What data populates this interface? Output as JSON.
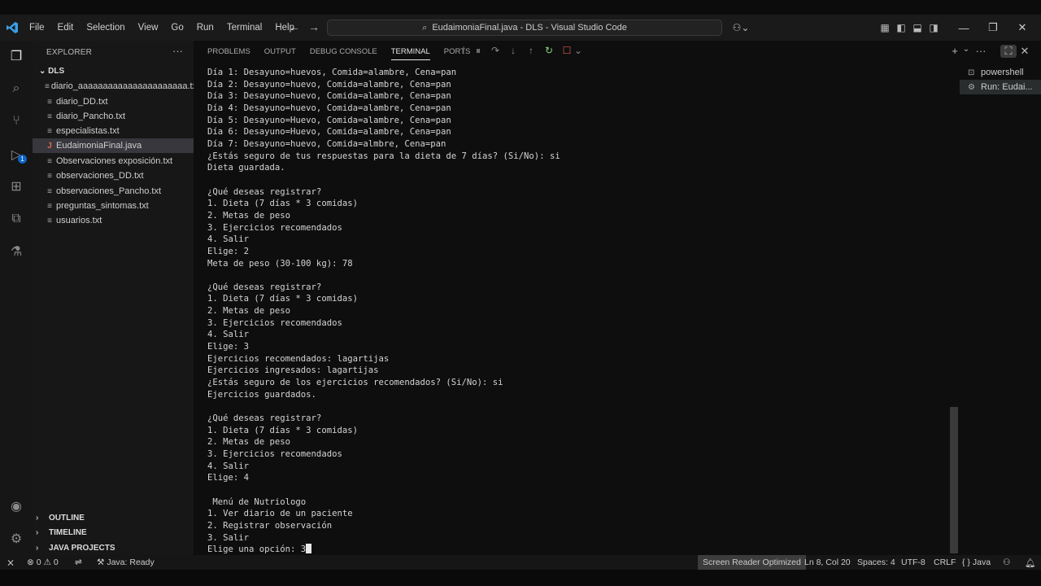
{
  "titlebar": {
    "menu": [
      "File",
      "Edit",
      "Selection",
      "View",
      "Go",
      "Run",
      "Terminal",
      "Help"
    ],
    "command_center": "EudaimoniaFinal.java - DLS - Visual Studio Code"
  },
  "sidebar": {
    "title": "EXPLORER",
    "folder": "DLS",
    "files": [
      "diario_aaaaaaaaaaaaaaaaaaaaaa.txt",
      "diario_DD.txt",
      "diario_Pancho.txt",
      "especialistas.txt",
      "EudaimoniaFinal.java",
      "Observaciones exposición.txt",
      "observaciones_DD.txt",
      "observaciones_Pancho.txt",
      "preguntas_sintomas.txt",
      "usuarios.txt"
    ],
    "sections": [
      "OUTLINE",
      "TIMELINE",
      "JAVA PROJECTS"
    ]
  },
  "activity": {
    "badge": "1"
  },
  "panel": {
    "tabs": [
      "PROBLEMS",
      "OUTPUT",
      "DEBUG CONSOLE",
      "TERMINAL",
      "PORTS"
    ],
    "terminals": [
      "powershell",
      "Run: Eudai..."
    ]
  },
  "terminal_lines": [
    "Día 1: Desayuno=huevos, Comida=alambre, Cena=pan",
    "Día 2: Desayuno=huevo, Comida=alambre, Cena=pan",
    "Día 3: Desayuno=huevo, Comida=alambre, Cena=pan",
    "Día 4: Desayuno=huevo, Comida=alambre, Cena=pan",
    "Día 5: Desayuno=Huevo, Comida=alambre, Cena=pan",
    "Día 6: Desayuno=Huevo, Comida=alambre, Cena=pan",
    "Día 7: Desayuno=huevo, Comida=almbre, Cena=pan",
    "¿Estás seguro de tus respuestas para la dieta de 7 días? (Si/No): si",
    "Dieta guardada.",
    "",
    "¿Qué deseas registrar?",
    "1. Dieta (7 días * 3 comidas)",
    "2. Metas de peso",
    "3. Ejercicios recomendados",
    "4. Salir",
    "Elige: 2",
    "Meta de peso (30-100 kg): 78",
    "",
    "¿Qué deseas registrar?",
    "1. Dieta (7 días * 3 comidas)",
    "2. Metas de peso",
    "3. Ejercicios recomendados",
    "4. Salir",
    "Elige: 3",
    "Ejercicios recomendados: lagartijas",
    "Ejercicios ingresados: lagartijas",
    "¿Estás seguro de los ejercicios recomendados? (Si/No): si",
    "Ejercicios guardados.",
    "",
    "¿Qué deseas registrar?",
    "1. Dieta (7 días * 3 comidas)",
    "2. Metas de peso",
    "3. Ejercicios recomendados",
    "4. Salir",
    "Elige: 4",
    "",
    " Menú de Nutriologo",
    "1. Ver diario de un paciente",
    "2. Registrar observación",
    "3. Salir",
    "Elige una opción: 3"
  ],
  "status": {
    "errors": "0",
    "warnings": "0",
    "java": "Java: Ready",
    "screen_reader": "Screen Reader Optimized",
    "position": "Ln 8, Col 20",
    "spaces": "Spaces: 4",
    "encoding": "UTF-8",
    "eol": "CRLF",
    "language": "Java"
  }
}
